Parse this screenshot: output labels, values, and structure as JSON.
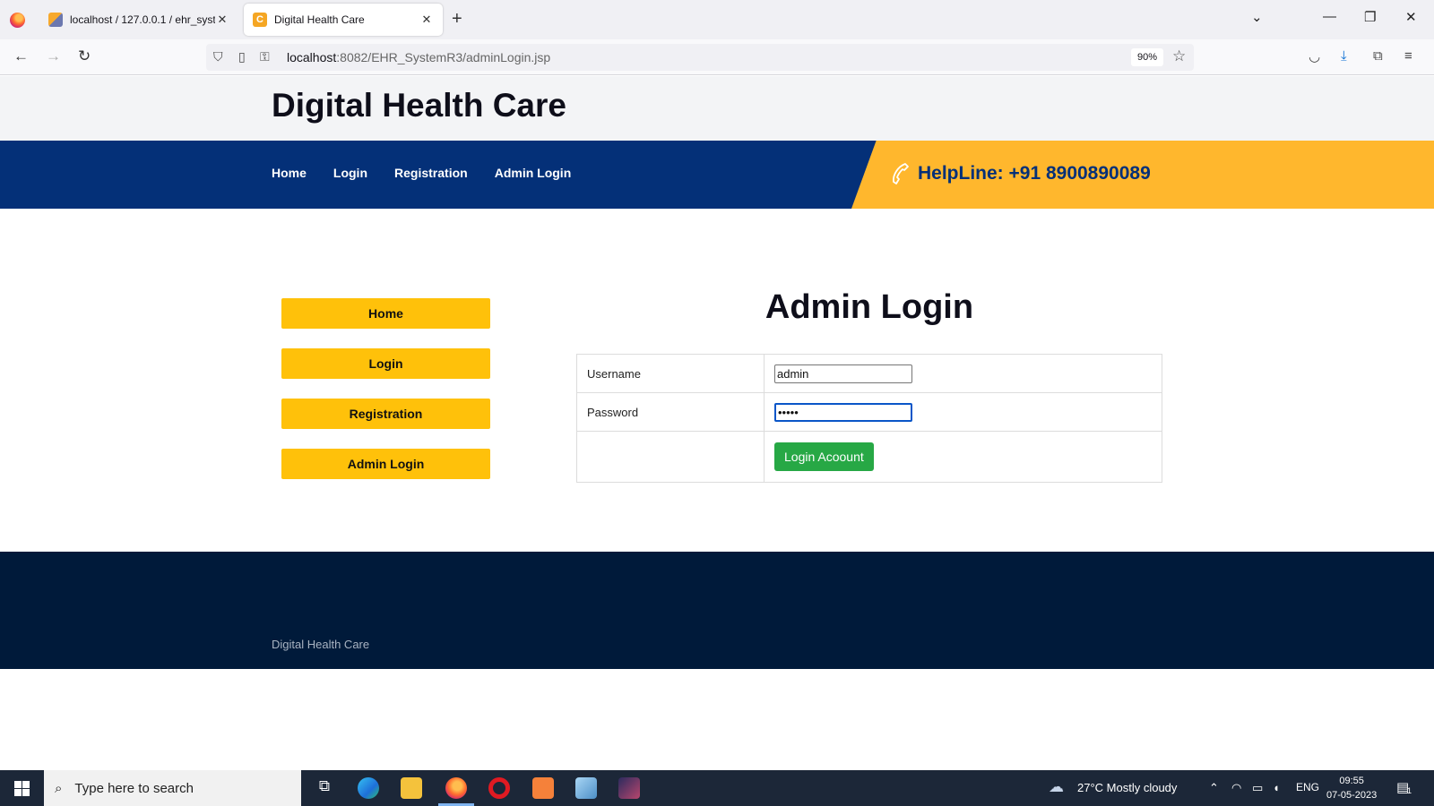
{
  "browser": {
    "tabs": [
      {
        "title": "localhost / 127.0.0.1 / ehr_system",
        "close": "✕"
      },
      {
        "title": "Digital Health Care",
        "close": "✕"
      }
    ],
    "new_tab": "+",
    "url_host": "localhost",
    "url_path": ":8082/EHR_SystemR3/adminLogin.jsp",
    "zoom": "90%",
    "window_controls": {
      "minimize": "—",
      "restore": "❐",
      "close": "✕"
    }
  },
  "site": {
    "title": "Digital Health Care",
    "nav": [
      "Home",
      "Login",
      "Registration",
      "Admin Login"
    ],
    "helpline": "HelpLine: +91 8900890089",
    "sidebar": [
      "Home",
      "Login",
      "Registration",
      "Admin Login"
    ],
    "heading": "Admin Login",
    "form": {
      "username_label": "Username",
      "username_value": "admin",
      "password_label": "Password",
      "password_value": "admin",
      "submit_label": "Login Acoount"
    },
    "footer_text": "Digital Health Care"
  },
  "taskbar": {
    "search_placeholder": "Type here to search",
    "weather": "27°C  Mostly cloudy",
    "language": "ENG",
    "time": "09:55",
    "date": "07-05-2023",
    "notifications": "1"
  },
  "colors": {
    "nav_blue": "#043078",
    "helpline_yellow": "#ffb72d",
    "sidebar_button": "#ffc10a",
    "submit_green": "#27a845",
    "footer_navy": "#001a3a"
  }
}
